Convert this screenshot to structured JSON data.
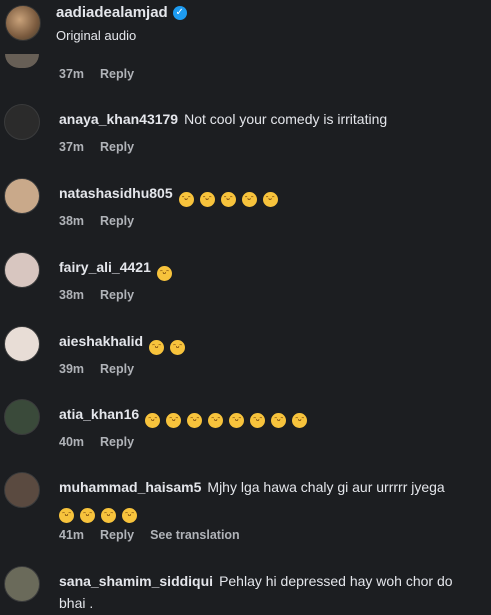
{
  "header": {
    "username": "aadiadealamjad",
    "subtitle": "Original audio"
  },
  "top_meta": {
    "time": "37m",
    "reply": "Reply"
  },
  "comments": [
    {
      "user": "anaya_khan43179",
      "text": "Not cool your comedy is irritating",
      "time": "37m",
      "reply": "Reply",
      "emojis": 0,
      "avatar_color": "#2b2b2b"
    },
    {
      "user": "natashasidhu805",
      "text": "",
      "time": "38m",
      "reply": "Reply",
      "emojis": 5,
      "avatar_color": "#c9a98a"
    },
    {
      "user": "fairy_ali_4421",
      "text": "",
      "time": "38m",
      "reply": "Reply",
      "emojis": 1,
      "avatar_color": "#d8c6c0"
    },
    {
      "user": "aieshakhalid",
      "text": "",
      "time": "39m",
      "reply": "Reply",
      "emojis": 2,
      "avatar_color": "#e8ddd6"
    },
    {
      "user": "atia_khan16",
      "text": "",
      "time": "40m",
      "reply": "Reply",
      "emojis": 8,
      "avatar_color": "#3a4a3a"
    },
    {
      "user": "muhammad_haisam5",
      "text": "Mjhy lga hawa chaly gi aur urrrrr jyega",
      "time": "41m",
      "reply": "Reply",
      "see_translation": "See translation",
      "emojis": 4,
      "avatar_color": "#5a4a40"
    },
    {
      "user": "sana_shamim_siddiqui",
      "text": "Pehlay hi depressed hay woh chor do bhai .",
      "time": "",
      "reply": "",
      "emojis": 0,
      "avatar_color": "#6a6a5a"
    }
  ],
  "emoji_icon": "grinning-squinting-face-icon",
  "colors": {
    "background": "#1c1e21",
    "text": "#e4e6eb",
    "muted": "#b0b3b8",
    "verified": "#1d9bf0"
  }
}
